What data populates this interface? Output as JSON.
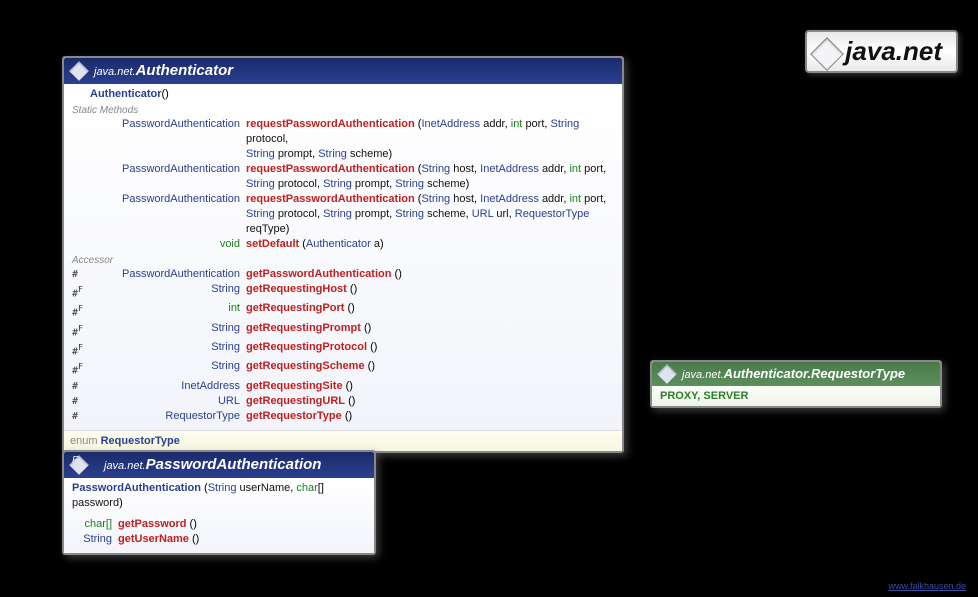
{
  "packageLabel": "java.net",
  "footer": "www.falkhausen.de",
  "authenticator": {
    "pkg": "java.net.",
    "name": "Authenticator",
    "ctor": "Authenticator",
    "ctorArgs": "()",
    "staticLabel": "Static Methods",
    "accessorLabel": "Accessor",
    "statics": [
      {
        "ret": "PasswordAuthentication",
        "name": "requestPasswordAuthentication",
        "argsHtml": "(<span class='type'>InetAddress</span> <span class='pname'>addr</span>, <span class='kw'>int</span> <span class='pname'>port</span>, <span class='type'>String</span> <span class='pname'>protocol</span>,<br><span class='type'>String</span> <span class='pname'>prompt</span>, <span class='type'>String</span> <span class='pname'>scheme</span>)"
      },
      {
        "ret": "PasswordAuthentication",
        "name": "requestPasswordAuthentication",
        "argsHtml": "(<span class='type'>String</span> <span class='pname'>host</span>, <span class='type'>InetAddress</span> <span class='pname'>addr</span>, <span class='kw'>int</span> <span class='pname'>port</span>,<br><span class='type'>String</span> <span class='pname'>protocol</span>, <span class='type'>String</span> <span class='pname'>prompt</span>, <span class='type'>String</span> <span class='pname'>scheme</span>)"
      },
      {
        "ret": "PasswordAuthentication",
        "name": "requestPasswordAuthentication",
        "argsHtml": "(<span class='type'>String</span> <span class='pname'>host</span>, <span class='type'>InetAddress</span> <span class='pname'>addr</span>, <span class='kw'>int</span> <span class='pname'>port</span>,<br><span class='type'>String</span> <span class='pname'>protocol</span>, <span class='type'>String</span> <span class='pname'>prompt</span>, <span class='type'>String</span> <span class='pname'>scheme</span>, <span class='type'>URL</span> <span class='pname'>url</span>, <span class='type'>RequestorType</span> <span class='pname'>reqType</span>)"
      },
      {
        "ret": "void",
        "retClass": "kw",
        "name": "setDefault",
        "argsHtml": "(<span class='type'>Authenticator</span> <span class='pname'>a</span>)"
      }
    ],
    "accessors": [
      {
        "mod": "#",
        "ret": "PasswordAuthentication",
        "name": "getPasswordAuthentication",
        "args": "()"
      },
      {
        "mod": "#F",
        "ret": "String",
        "name": "getRequestingHost",
        "args": "()"
      },
      {
        "mod": "#F",
        "ret": "int",
        "retClass": "kw",
        "name": "getRequestingPort",
        "args": "()"
      },
      {
        "mod": "#F",
        "ret": "String",
        "name": "getRequestingPrompt",
        "args": "()"
      },
      {
        "mod": "#F",
        "ret": "String",
        "name": "getRequestingProtocol",
        "args": "()"
      },
      {
        "mod": "#F",
        "ret": "String",
        "name": "getRequestingScheme",
        "args": "()"
      },
      {
        "mod": "#",
        "ret": "InetAddress",
        "name": "getRequestingSite",
        "args": "()"
      },
      {
        "mod": "#",
        "ret": "URL",
        "name": "getRequestingURL",
        "args": "()"
      },
      {
        "mod": "#",
        "ret": "RequestorType",
        "name": "getRequestorType",
        "args": "()"
      }
    ],
    "enumLinePrefix": "enum ",
    "enumLineType": "RequestorType"
  },
  "pwAuth": {
    "pkg": "java.net.",
    "name": "PasswordAuthentication",
    "fFlag": "F",
    "ctor": "PasswordAuthentication",
    "ctorArgsHtml": "(<span class='type'>String</span> <span class='pname'>userName</span>, <span class='kw'>char</span>[] <span class='pname'>password</span>)",
    "methods": [
      {
        "ret": "char[]",
        "retClass": "kw",
        "name": "getPassword",
        "args": "()"
      },
      {
        "ret": "String",
        "name": "getUserName",
        "args": "()"
      }
    ]
  },
  "reqType": {
    "pkg": "java.net.",
    "name": "Authenticator.RequestorType",
    "values": "PROXY, SERVER"
  }
}
